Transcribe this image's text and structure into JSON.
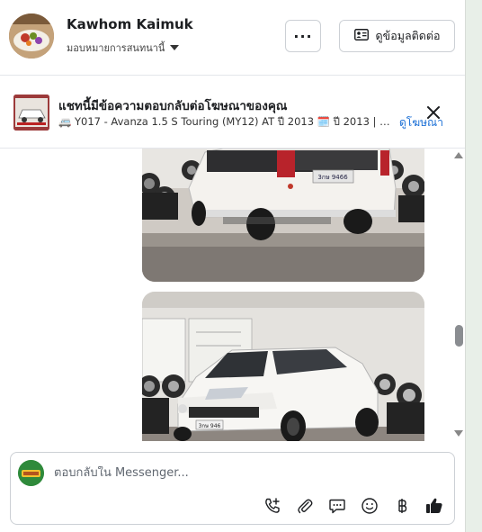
{
  "header": {
    "contact_name": "Kawhom Kaimuk",
    "assign_label": "มอบหมายการสนทนานี้",
    "more_label": "···",
    "contact_button_label": "ดูข้อมูลติดต่อ"
  },
  "ad_banner": {
    "title": "แชทนี้มีข้อความตอบกลับต่อโฆษณาของคุณ",
    "description": "🚐 Y017 - Avanza 1.5 S Touring (MY12) AT ปี 2013 🗓️ ปี 2013 | ⚛️ เ...",
    "view_ad_label": "ดูโฆษณา"
  },
  "messages": {
    "photo1": {
      "plate": "3กษ 9466"
    },
    "photo2": {
      "plate": "3กษ 946"
    }
  },
  "composer": {
    "placeholder": "ตอบกลับใน Messenger...",
    "tools": [
      "phone-plus-icon",
      "paperclip-icon",
      "chat-bubble-icon",
      "smiley-icon",
      "baht-icon",
      "thumbs-up-icon"
    ]
  },
  "colors": {
    "link": "#1a6fd6",
    "border": "#ccd0d5",
    "right_panel": "#e8efe8"
  }
}
